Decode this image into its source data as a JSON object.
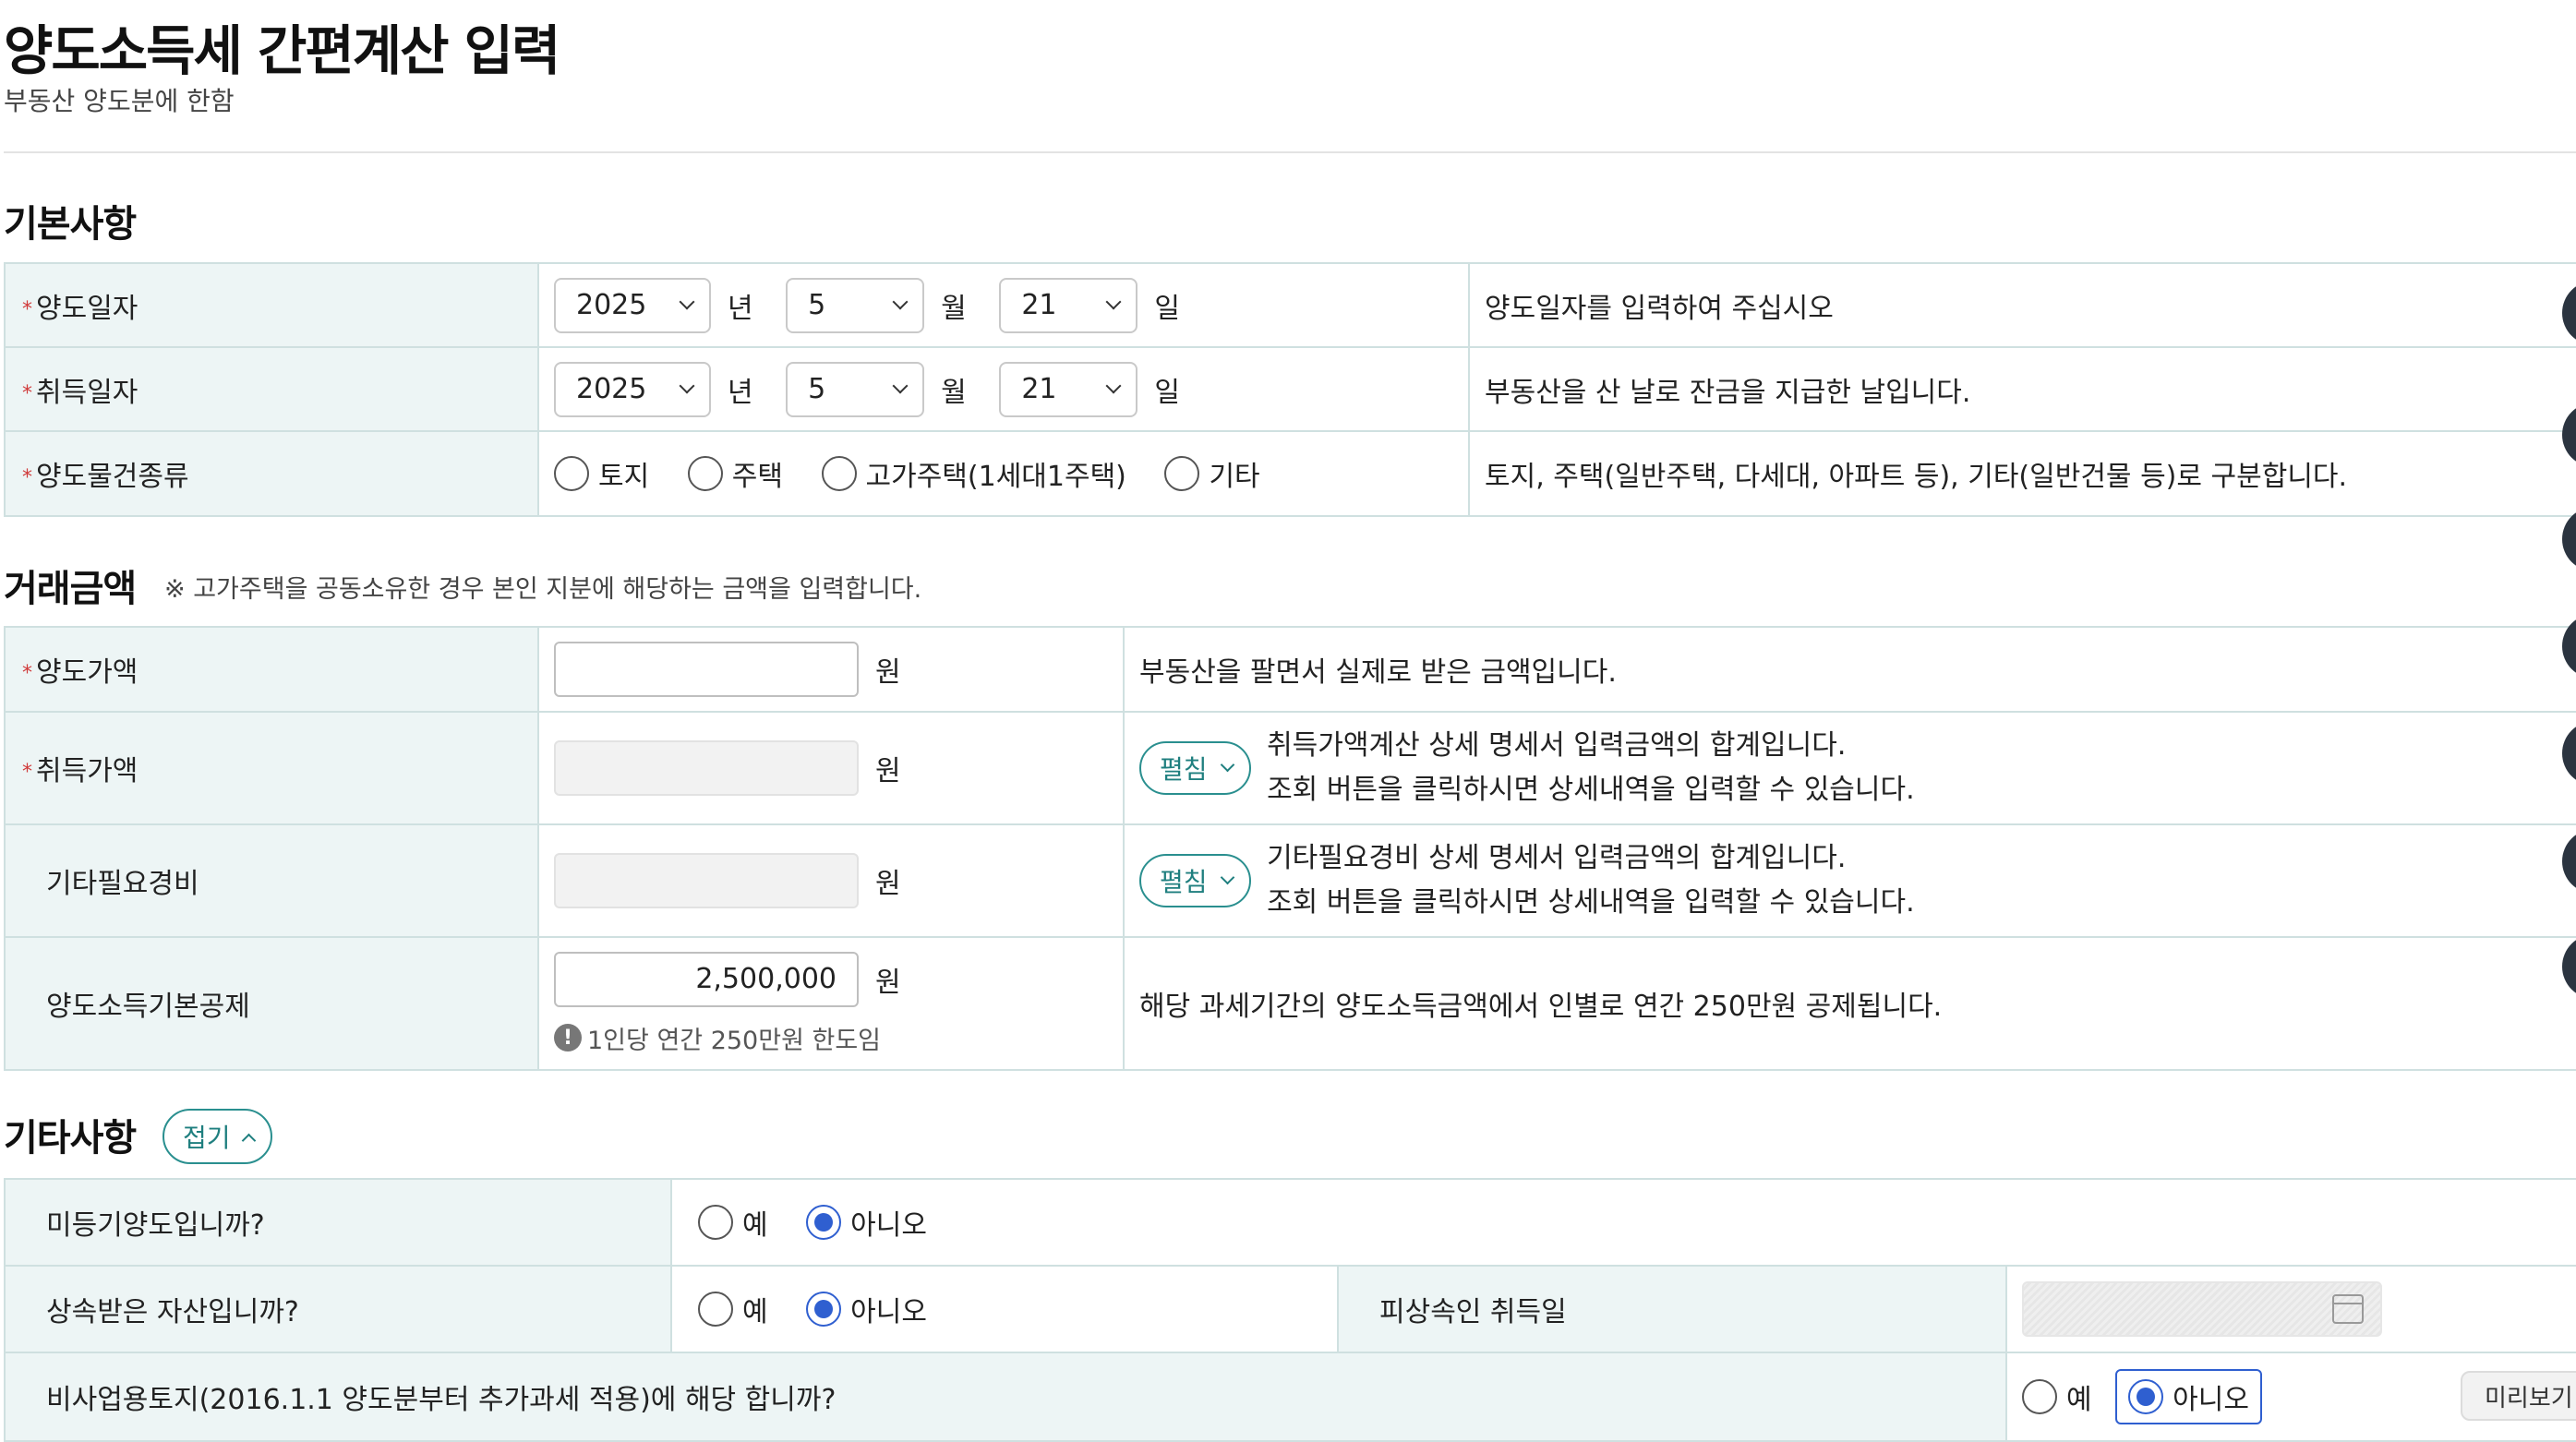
{
  "header": {
    "title": "양도소득세 간편계산 입력",
    "subtitle": "부동산 양도분에 한함"
  },
  "basic": {
    "title": "기본사항",
    "year_unit": "년",
    "month_unit": "월",
    "day_unit": "일",
    "transfer_date": {
      "label": "양도일자",
      "year": "2025",
      "month": "5",
      "day": "21",
      "help": "양도일자를 입력하여 주십시오"
    },
    "acquire_date": {
      "label": "취득일자",
      "year": "2025",
      "month": "5",
      "day": "21",
      "help": "부동산을 산 날로 잔금을 지급한 날입니다."
    },
    "property_type": {
      "label": "양도물건종류",
      "options": [
        "토지",
        "주택",
        "고가주택(1세대1주택)",
        "기타"
      ],
      "help": "토지, 주택(일반주택, 다세대, 아파트 등), 기타(일반건물 등)로 구분합니다."
    }
  },
  "amount": {
    "title": "거래금액",
    "note": "※ 고가주택을 공동소유한 경우 본인 지분에 해당하는 금액을 입력합니다.",
    "won": "원",
    "expand_label": "펼침",
    "transfer_price": {
      "label": "양도가액",
      "value": "",
      "help": "부동산을 팔면서 실제로 받은 금액입니다."
    },
    "acquire_price": {
      "label": "취득가액",
      "help1": "취득가액계산 상세 명세서 입력금액의 합계입니다.",
      "help2": "조회 버튼을 클릭하시면 상세내역을 입력할 수 있습니다."
    },
    "other_expense": {
      "label": "기타필요경비",
      "help1": "기타필요경비 상세 명세서 입력금액의 합계입니다.",
      "help2": "조회 버튼을 클릭하시면 상세내역을 입력할 수 있습니다."
    },
    "basic_deduction": {
      "label": "양도소득기본공제",
      "value": "2,500,000",
      "hint": "1인당 연간 250만원 한도임",
      "help": "해당 과세기간의 양도소득금액에서 인별로 연간 250만원 공제됩니다."
    }
  },
  "other": {
    "title": "기타사항",
    "collapse_label": "접기",
    "yes": "예",
    "no": "아니오",
    "unregistered": {
      "label": "미등기양도입니까?",
      "selected": "아니오"
    },
    "inherited": {
      "label": "상속받은 자산입니까?",
      "selected": "아니오",
      "decedent_label": "피상속인 취득일"
    },
    "non_business_land": {
      "label": "비사업용토지(2016.1.1 양도분부터 추가과세 적용)에 해당 합니까?",
      "selected": "아니오"
    }
  },
  "tooltip": {
    "preview": "미리보기"
  },
  "colors": {
    "accent": "#2f5fd0",
    "teal": "#1f7f7f",
    "label_bg": "#edf5f5",
    "border": "#cfe0e0",
    "required": "#d03b3b"
  }
}
